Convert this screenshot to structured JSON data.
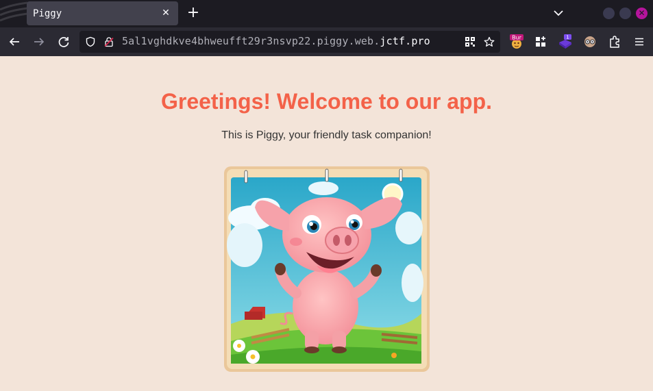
{
  "browser": {
    "tab": {
      "title": "Piggy"
    },
    "address": {
      "url_prefix": "5al1vghdkve4bhweufft29r3nsvp22.piggy.web.",
      "url_domain": "jctf.pro"
    },
    "extensions": {
      "burp_badge": "Bur",
      "counter_badge": "1"
    },
    "icons": {
      "back": "back-arrow-icon",
      "forward": "forward-arrow-icon",
      "reload": "reload-icon",
      "menu": "hamburger-menu-icon"
    }
  },
  "page": {
    "heading": "Greetings! Welcome to our app.",
    "subtitle": "This is Piggy, your friendly task companion!",
    "image": "cartoon pig on farm illustration"
  },
  "colors": {
    "page_bg": "#f3e4d9",
    "heading": "#f36249",
    "toolbar": "#2b2a33",
    "tab_active": "#42414d"
  }
}
